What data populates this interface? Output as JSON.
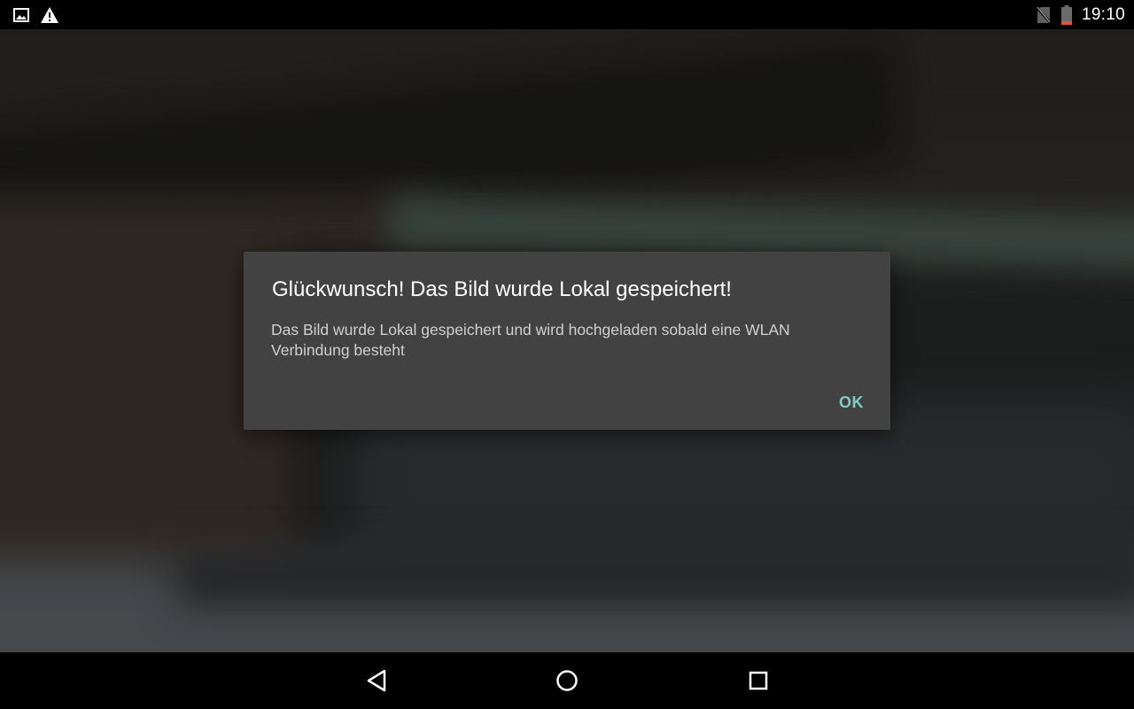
{
  "status_bar": {
    "time": "19:10",
    "icons": [
      "image-notification-icon",
      "warning-icon",
      "no-sim-icon",
      "battery-low-icon"
    ],
    "battery_color": "#e0533c"
  },
  "dialog": {
    "title": "Glückwunsch! Das Bild wurde Lokal gespeichert!",
    "message": "Das Bild wurde Lokal gespeichert und wird hochgeladen sobald eine WLAN Verbindung besteht",
    "ok_label": "OK",
    "background_color": "#424242",
    "accent_color": "#80cbc4"
  },
  "nav_bar": {
    "icons": [
      "back-icon",
      "home-icon",
      "recents-icon"
    ]
  }
}
